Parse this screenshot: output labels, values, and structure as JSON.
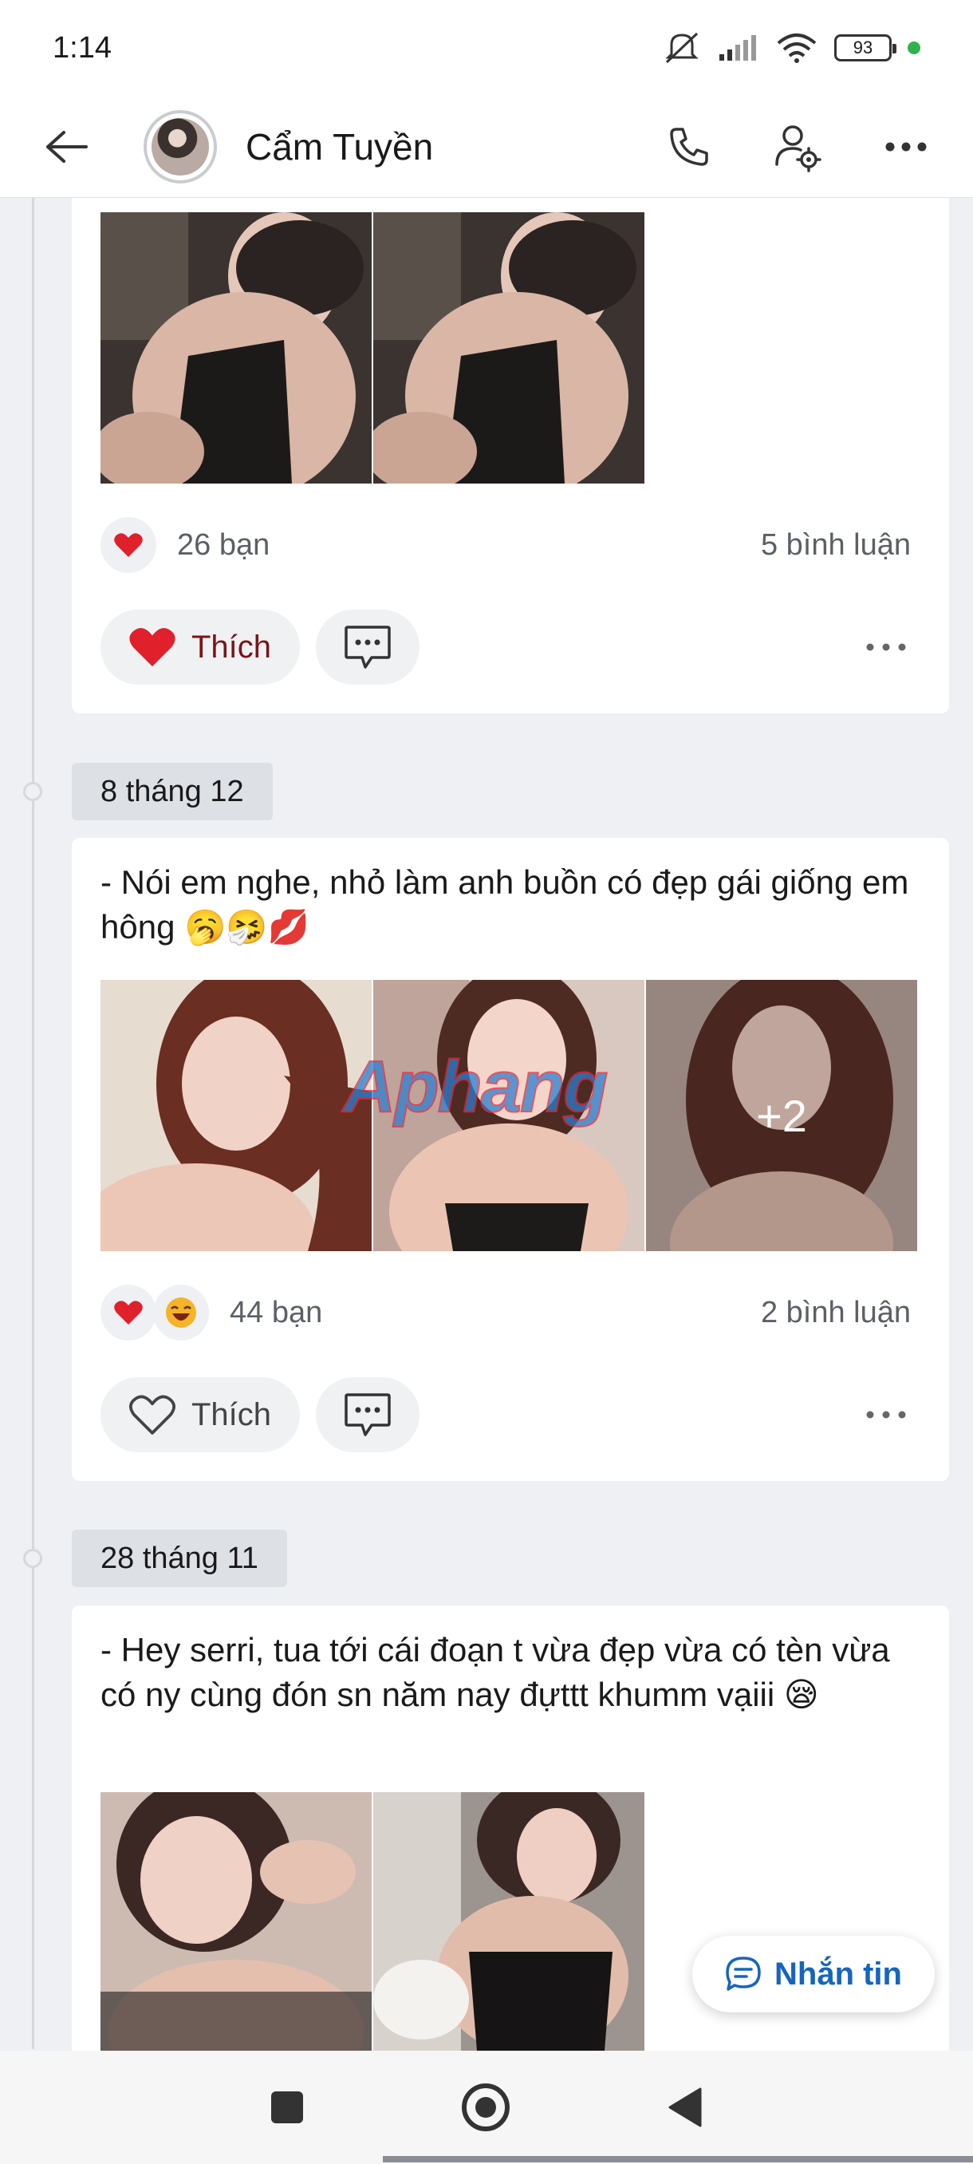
{
  "status_bar": {
    "time": "1:14",
    "battery": "93"
  },
  "header": {
    "name": "Cẩm Tuyền"
  },
  "posts": [
    {
      "reactions": [
        "heart"
      ],
      "reaction_count": "26 bạn",
      "comment_count": "5 bình luận",
      "like_label": "Thích",
      "liked": true
    },
    {
      "date": "8 tháng 12",
      "text": "- Nói em nghe, nhỏ làm anh buồn có đẹp gái giống em hông 🥱🤧💋",
      "reactions": [
        "heart",
        "laughing"
      ],
      "reaction_count": "44 bạn",
      "comment_count": "2 bình luận",
      "like_label": "Thích",
      "liked": false,
      "more_photos": "+2",
      "watermark": "Aphang"
    },
    {
      "date": "28 tháng 11",
      "text": "- Hey serri, tua tới cái đoạn t vừa đẹp vừa có tèn vừa có ny cùng đón sn năm nay đựttt khumm vạiii 😪"
    }
  ],
  "message_button": {
    "label": "Nhắn tin"
  },
  "colors": {
    "accent": "#1565c0",
    "liked": "#7a1418",
    "heart": "#e0202a"
  }
}
